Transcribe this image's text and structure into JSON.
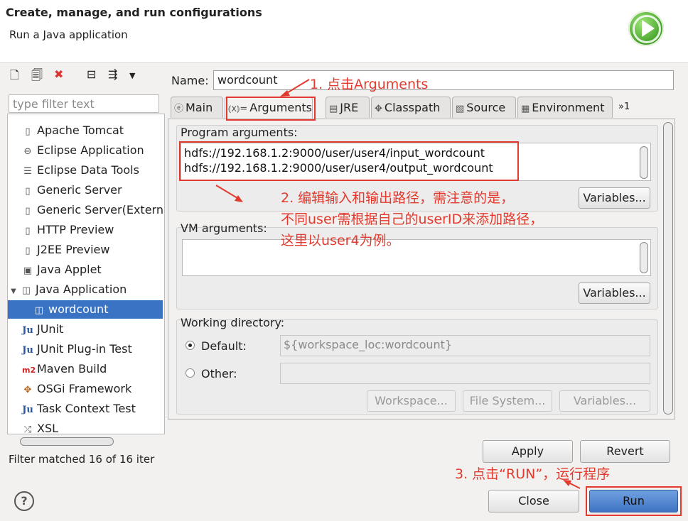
{
  "header": {
    "title": "Create, manage, and run configurations",
    "subtitle": "Run a Java application"
  },
  "left": {
    "filter_placeholder": "type filter text",
    "items": [
      {
        "label": "Apache Tomcat",
        "icon": "server-icon"
      },
      {
        "label": "Eclipse Application",
        "icon": "eclipse-icon"
      },
      {
        "label": "Eclipse Data Tools",
        "icon": "database-icon"
      },
      {
        "label": "Generic Server",
        "icon": "server-icon"
      },
      {
        "label": "Generic Server(Extern",
        "icon": "server-icon"
      },
      {
        "label": "HTTP Preview",
        "icon": "server-icon"
      },
      {
        "label": "J2EE Preview",
        "icon": "server-icon"
      },
      {
        "label": "Java Applet",
        "icon": "applet-icon"
      },
      {
        "label": "Java Application",
        "icon": "java-app-icon"
      },
      {
        "label": "wordcount",
        "icon": "java-app-icon"
      },
      {
        "label": "JUnit",
        "icon": "junit-icon"
      },
      {
        "label": "JUnit Plug-in Test",
        "icon": "junit-plugin-icon"
      },
      {
        "label": "Maven Build",
        "icon": "maven-icon"
      },
      {
        "label": "OSGi Framework",
        "icon": "osgi-icon"
      },
      {
        "label": "Task Context Test",
        "icon": "task-icon"
      },
      {
        "label": "XSL",
        "icon": "xsl-icon"
      }
    ],
    "filter_status": "Filter matched 16 of 16 iter"
  },
  "name": {
    "label": "Name:",
    "value": "wordcount"
  },
  "tabs": [
    "Main",
    "Arguments",
    "JRE",
    "Classpath",
    "Source",
    "Environment",
    "»1"
  ],
  "program_args": {
    "label": "Program arguments:",
    "line1": "hdfs://192.168.1.2:9000/user/user4/input_wordcount",
    "line2": "hdfs://192.168.1.2:9000/user/user4/output_wordcount",
    "variables": "Variables..."
  },
  "vm_args": {
    "label": "VM arguments:",
    "value": "",
    "variables": "Variables..."
  },
  "workdir": {
    "label": "Working directory:",
    "default_label": "Default:",
    "default_value": "${workspace_loc:wordcount}",
    "other_label": "Other:",
    "workspace": "Workspace...",
    "filesystem": "File System...",
    "variables": "Variables..."
  },
  "buttons": {
    "apply": "Apply",
    "revert": "Revert",
    "close": "Close",
    "run": "Run",
    "help": "?"
  },
  "annotations": {
    "a1": "1. 点击Arguments",
    "a2_line1": "2. 编辑输入和输出路径，需注意的是，",
    "a2_line2": "不同user需根据自己的userID来添加路径，",
    "a2_line3": "这里以user4为例。",
    "a3": "3. 点击“RUN”，运行程序"
  },
  "colors": {
    "annotation": "#e23a2e",
    "selection": "#3a72c4",
    "run_button": "#4f83cc"
  }
}
